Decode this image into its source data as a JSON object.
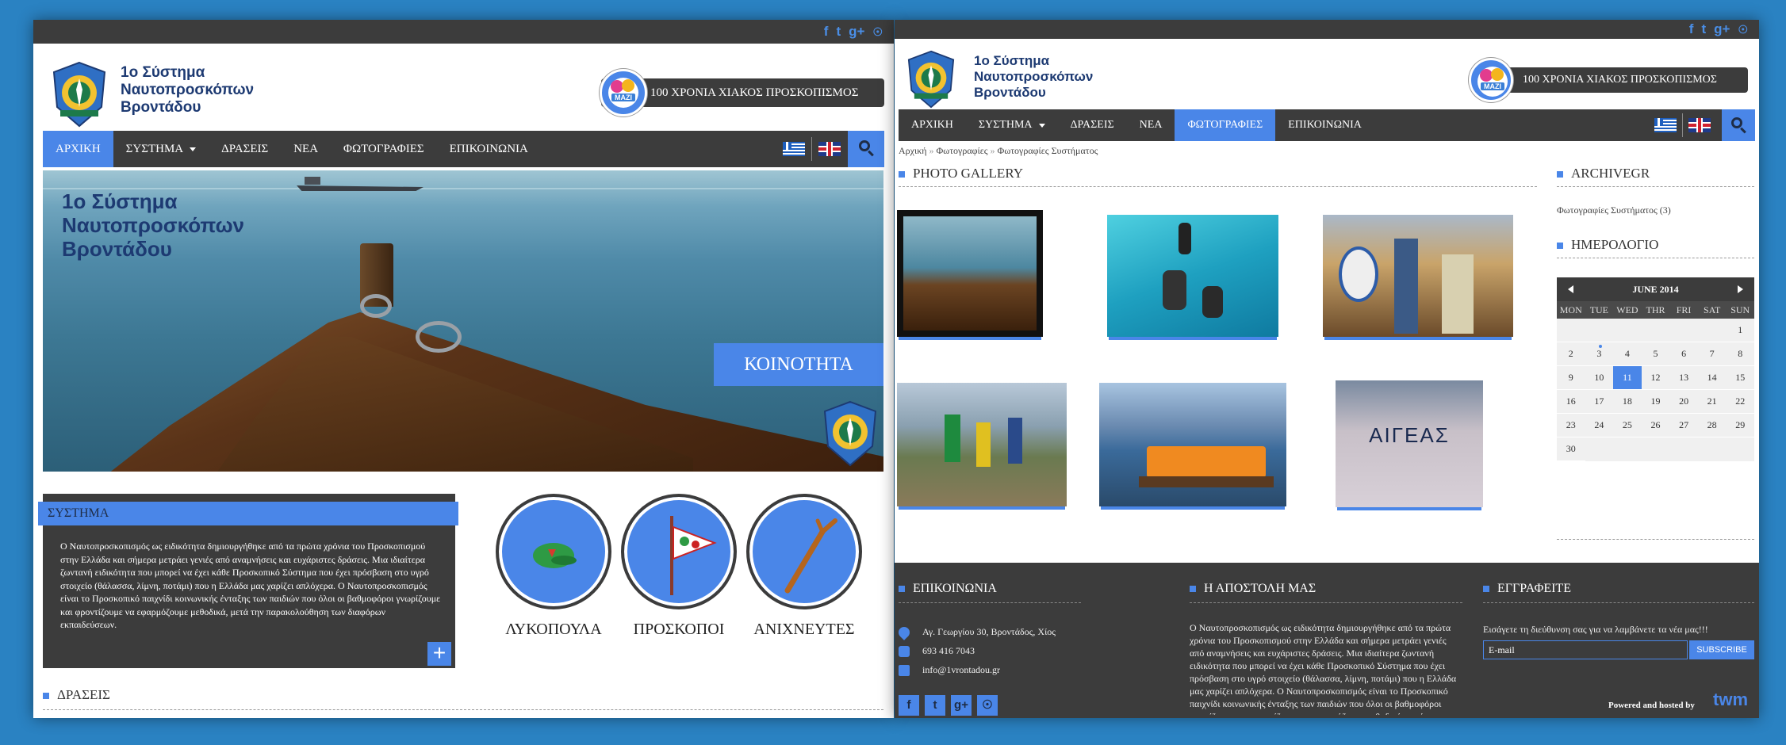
{
  "social": [
    "f",
    "t",
    "g+",
    "rss"
  ],
  "site": {
    "name_line1": "1ο Σύστημα",
    "name_line2": "Ναυτοπροσκόπων",
    "name_line3": "Βροντάδου",
    "banner": "100 ΧΡΟΝΙΑ ΧΙΑΚΟΣ ΠΡΟΣΚΟΠΙΣΜΟΣ",
    "badge": "ΜΑΖΙ"
  },
  "nav": {
    "items": [
      {
        "label": "ΑΡΧΙΚΗ"
      },
      {
        "label": "ΣΥΣΤΗΜΑ"
      },
      {
        "label": "ΔΡΑΣΕΙΣ"
      },
      {
        "label": "ΝΕΑ"
      },
      {
        "label": "ΦΩΤΟΓΡΑΦΙΕΣ"
      },
      {
        "label": "ΕΠΙΚΟΙΝΩΝΙΑ"
      }
    ]
  },
  "home": {
    "hero_line1": "1ο Σύστημα",
    "hero_line2": "Ναυτοπροσκόπων",
    "hero_line3": "Βροντάδου",
    "hero_caption": "ΚΟΙΝΟΤΗΤΑ",
    "section_title": "ΣΥΣΤΗΜΑ",
    "section_text": "Ο Ναυτοπροσκοπισμός ως ειδικότητα δημιουργήθηκε από τα πρώτα χρόνια του Προσκοπισμού στην Ελλάδα και σήμερα μετράει γενιές από αναμνήσεις και ευχάριστες δράσεις. Μια ιδιαίτερα ζωντανή ειδικότητα που μπορεί να έχει κάθε Προσκοπικό Σύστημα που έχει πρόσβαση στο υγρό στοιχείο (θάλασσα, λίμνη, ποτάμι) που η Ελλάδα μας χαρίζει απλόχερα. Ο Ναυτοπροσκοπισμός είναι το Προσκοπικό παιχνίδι κοινωνικής ένταξης των παιδιών που όλοι οι βαθμοφόροι γνωρίζουμε και φροντίζουμε να εφαρμόζουμε μεθοδικά, μετά την παρακολούθηση των διαφόρων εκπαιδεύσεων.",
    "sections": [
      "ΛΥΚΟΠΟΥΛΑ",
      "ΠΡΟΣΚΟΠΟΙ",
      "ΑΝΙΧΝΕΥΤΕΣ"
    ],
    "next_section": "ΔΡΑΣΕΙΣ"
  },
  "gallery": {
    "breadcrumb": [
      "Αρχική",
      "Φωτογραφίες",
      "Φωτογραφίες Συστήματος"
    ],
    "title": "PHOTO GALLERY"
  },
  "sidebar": {
    "archive_title": "ARCHIVEGR",
    "archive_item": "Φωτογραφίες Συστήματος (3)",
    "calendar_title": "ΗΜΕΡΟΛΟΓΙΟ",
    "month": "JUNE 2014",
    "weekdays": [
      "MON",
      "TUE",
      "WED",
      "THR",
      "FRI",
      "SAT",
      "SUN"
    ],
    "days": [
      "",
      "",
      "",
      "",
      "",
      "",
      "1",
      "2",
      "3",
      "4",
      "5",
      "6",
      "7",
      "8",
      "9",
      "10",
      "11",
      "12",
      "13",
      "14",
      "15",
      "16",
      "17",
      "18",
      "19",
      "20",
      "21",
      "22",
      "23",
      "24",
      "25",
      "26",
      "27",
      "28",
      "29",
      "30"
    ],
    "today": "11",
    "event_day": "3"
  },
  "footer": {
    "contact_title": "ΕΠΙΚΟΙΝΩΝΙΑ",
    "address": "Αγ. Γεωργίου 30, Βροντάδος, Χίος",
    "phone": "693 416 7043",
    "email": "info@1vrontadou.gr",
    "mission_title": "Η ΑΠΟΣΤΟΛΗ ΜΑΣ",
    "mission_text": "Ο Ναυτοπροσκοπισμός ως ειδικότητα δημιουργήθηκε από τα πρώτα χρόνια του Προσκοπισμού στην Ελλάδα και σήμερα μετράει γενιές από αναμνήσεις και ευχάριστες δράσεις. Μια ιδιαίτερα ζωντανή ειδικότητα που μπορεί να έχει κάθε Προσκοπικό Σύστημα που έχει πρόσβαση στο υγρό στοιχείο (θάλασσα, λίμνη, ποτάμι) που η Ελλάδα μας χαρίζει απλόχερα. Ο Ναυτοπροσκοπισμός είναι το Προσκοπικό παιχνίδι κοινωνικής ένταξης των παιδιών που όλοι οι βαθμοφόροι γνωρίζουμε και φροντίζουμε να εφαρμόζουμε μεθοδικά, μετά",
    "subscribe_title": "ΕΓΓΡΑΦΕΙΤΕ",
    "subscribe_text": "Εισάγετε τη διεύθυνση σας για να λαμβάνετε τα νέα μας!!!",
    "email_placeholder": "E-mail",
    "subscribe_button": "SUBSCRIBE",
    "powered": "Powered and hosted by",
    "host_logo": "twm"
  },
  "colors": {
    "accent": "#4a86e8",
    "dark": "#3c3c3c",
    "background": "#2a82c2"
  }
}
